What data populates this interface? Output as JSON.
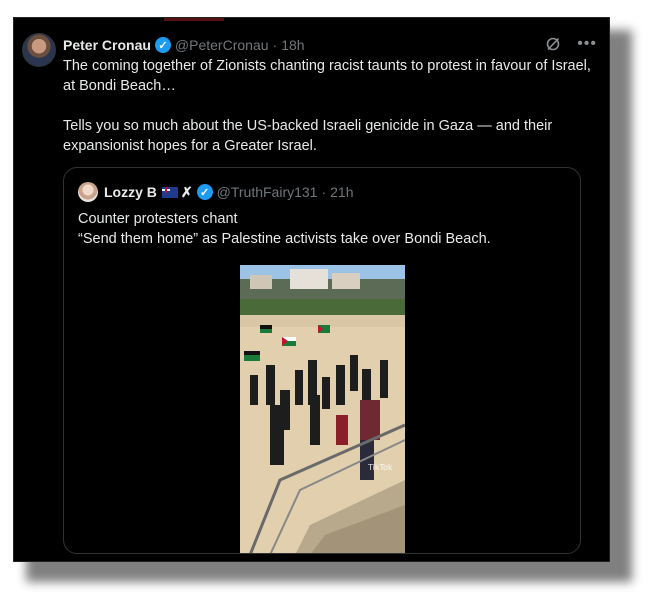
{
  "post": {
    "author_name": "Peter Cronau",
    "handle": "@PeterCronau",
    "time": "18h",
    "paragraph1": "The coming together of Zionists chanting racist taunts to protest in favour of Israel, at Bondi Beach…",
    "paragraph2": "Tells you so much about the US-backed Israeli genicide in Gaza — and their expansionist hopes for a Greater Israel.",
    "icons": {
      "verified": "verified-badge-icon",
      "grok": "grok-icon",
      "more": "more-icon"
    }
  },
  "quoted": {
    "author_name": "Lozzy B",
    "handle": "@TruthFairy131",
    "time": "21h",
    "line1": "Counter protesters chant",
    "line2": "“Send them home” as Palestine activists take over Bondi Beach.",
    "media_watermark": "TikTok",
    "icons": {
      "flag": "australian-flag-icon",
      "x": "x-mark-icon",
      "verified": "verified-badge-icon"
    }
  },
  "colors": {
    "background": "#000000",
    "text_primary": "#e7e9ea",
    "text_secondary": "#71767b",
    "verified_blue": "#1d9bf0",
    "border": "#2f3336"
  }
}
